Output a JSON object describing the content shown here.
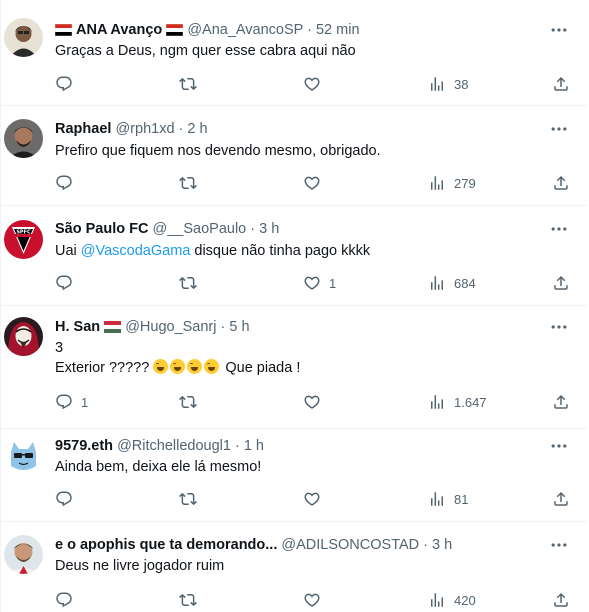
{
  "tweets": [
    {
      "name": "ANA Avanço",
      "handle": "@Ana_AvancoSP",
      "time": "· 52 min",
      "text": "Graças a Deus, ngm quer esse cabra aqui não",
      "replies": "",
      "retweets": "",
      "likes": "",
      "views": "38"
    },
    {
      "name": "Raphael",
      "handle": "@rph1xd",
      "time": "· 2 h",
      "text": "Prefiro que fiquem nos devendo mesmo, obrigado.",
      "replies": "",
      "retweets": "",
      "likes": "",
      "views": "279"
    },
    {
      "name": "São Paulo FC",
      "handle": "@__SaoPaulo",
      "time": "· 3 h",
      "text_before": "Uai ",
      "mention": "@VascodaGama",
      "text_after": " disque não tinha pago kkkk",
      "avatar_text": "SPFC",
      "replies": "",
      "retweets": "",
      "likes": "1",
      "views": "684"
    },
    {
      "name": "H. San",
      "handle": "@Hugo_Sanrj",
      "time": "· 5 h",
      "text_line1": "3",
      "text_line2_before": "Exterior ?????",
      "text_line2_after": " Que piada !",
      "replies": "1",
      "retweets": "",
      "likes": "",
      "views": "1.647"
    },
    {
      "name": "9579.eth",
      "handle": "@Ritchelledougl1",
      "time": "· 1 h",
      "text": "Ainda bem, deixa ele lá mesmo!",
      "replies": "",
      "retweets": "",
      "likes": "",
      "views": "81"
    },
    {
      "name": "e o apophis que ta demorando...",
      "handle": "@ADILSONCOSTAD",
      "time": "· 3 h",
      "text": "Deus ne livre jogador ruim",
      "replies": "",
      "retweets": "",
      "likes": "",
      "views": "420"
    }
  ],
  "icons": {
    "more": "more-icon",
    "reply": "reply-icon",
    "retweet": "retweet-icon",
    "like": "heart-icon",
    "views": "views-icon",
    "share": "share-icon"
  },
  "colors": {
    "text": "#0f1419",
    "secondary": "#536471",
    "link": "#1d9bf0",
    "divider": "#eff3f4"
  }
}
